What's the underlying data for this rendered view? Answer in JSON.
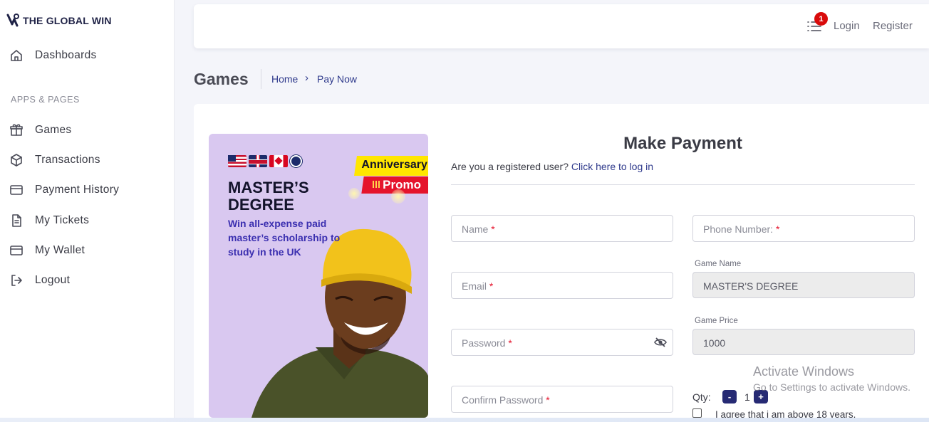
{
  "brand": {
    "name": "THE GLOBAL WIN"
  },
  "sidebar": {
    "section_label": "APPS & PAGES",
    "items": [
      {
        "label": "Dashboards",
        "icon": "home-icon"
      },
      {
        "label": "Games",
        "icon": "gift-icon"
      },
      {
        "label": "Transactions",
        "icon": "cube-icon"
      },
      {
        "label": "Payment History",
        "icon": "credit-card-icon"
      },
      {
        "label": "My Tickets",
        "icon": "document-icon"
      },
      {
        "label": "My Wallet",
        "icon": "wallet-icon"
      },
      {
        "label": "Logout",
        "icon": "logout-icon"
      }
    ]
  },
  "header": {
    "notification_count": "1",
    "login": "Login",
    "register": "Register"
  },
  "breadcrumb": {
    "title": "Games",
    "home": "Home",
    "current": "Pay Now",
    "separator": "›"
  },
  "promo": {
    "title": "MASTER’S DEGREE",
    "subtitle": "Win all-expense paid master’s scholarship to study in the UK",
    "tag_top": "Anniversary",
    "tag_bottom": "Promo"
  },
  "form": {
    "title": "Make Payment",
    "registered_question": "Are you a registered user?",
    "login_link": "Click here to log in",
    "name_placeholder": "Name",
    "phone_placeholder": "Phone Number:",
    "email_placeholder": "Email",
    "password_placeholder": "Password",
    "confirm_password_placeholder": "Confirm Password",
    "required_mark": "*",
    "game_name_label": "Game Name",
    "game_name_value": "MASTER'S DEGREE",
    "game_price_label": "Game Price",
    "game_price_value": "1000",
    "qty_label": "Qty:",
    "qty_value": "1",
    "qty_minus": "-",
    "qty_plus": "+",
    "agree_text": "I agree that i am above 18 years."
  },
  "watermark": {
    "line1": "Activate Windows",
    "line2": "Go to Settings to activate Windows."
  },
  "colors": {
    "accent": "#262a74",
    "link": "#2f3a8c",
    "badge": "#d90b0b",
    "required": "#e5142c",
    "promo_bg": "#d9c8f0"
  }
}
